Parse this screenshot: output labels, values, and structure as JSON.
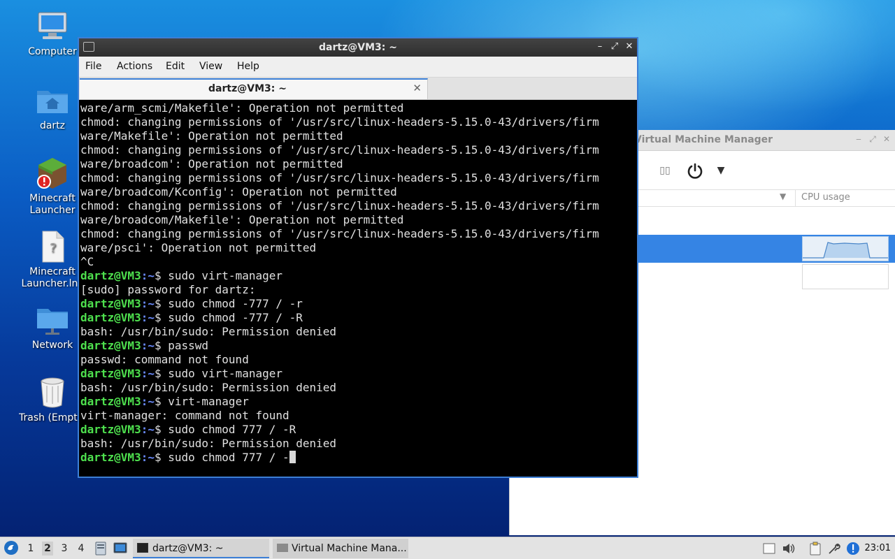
{
  "desktop": {
    "icons": [
      {
        "label": "Computer",
        "icon": "computer-icon"
      },
      {
        "label": "dartz",
        "icon": "home-folder-icon"
      },
      {
        "label": "Minecraft Launcher",
        "icon": "minecraft-icon"
      },
      {
        "label": "Minecraft Launcher.lnk",
        "icon": "file-icon"
      },
      {
        "label": "Network",
        "icon": "network-folder-icon"
      },
      {
        "label": "Trash (Empty)",
        "icon": "trash-icon"
      }
    ]
  },
  "terminal": {
    "title": "dartz@VM3: ~",
    "menu": [
      "File",
      "Actions",
      "Edit",
      "View",
      "Help"
    ],
    "tab_label": "dartz@VM3: ~",
    "tab_close": "✕",
    "prompt_user": "dartz@VM3",
    "prompt_path": ":~",
    "lines": [
      {
        "type": "out",
        "text": "ware/arm_scmi/Makefile': Operation not permitted"
      },
      {
        "type": "out",
        "text": "chmod: changing permissions of '/usr/src/linux-headers-5.15.0-43/drivers/firm"
      },
      {
        "type": "out",
        "text": "ware/Makefile': Operation not permitted"
      },
      {
        "type": "out",
        "text": "chmod: changing permissions of '/usr/src/linux-headers-5.15.0-43/drivers/firm"
      },
      {
        "type": "out",
        "text": "ware/broadcom': Operation not permitted"
      },
      {
        "type": "out",
        "text": "chmod: changing permissions of '/usr/src/linux-headers-5.15.0-43/drivers/firm"
      },
      {
        "type": "out",
        "text": "ware/broadcom/Kconfig': Operation not permitted"
      },
      {
        "type": "out",
        "text": "chmod: changing permissions of '/usr/src/linux-headers-5.15.0-43/drivers/firm"
      },
      {
        "type": "out",
        "text": "ware/broadcom/Makefile': Operation not permitted"
      },
      {
        "type": "out",
        "text": "chmod: changing permissions of '/usr/src/linux-headers-5.15.0-43/drivers/firm"
      },
      {
        "type": "out",
        "text": "ware/psci': Operation not permitted"
      },
      {
        "type": "out",
        "text": "^C"
      },
      {
        "type": "cmd",
        "text": "$ sudo virt-manager"
      },
      {
        "type": "out",
        "text": "[sudo] password for dartz:"
      },
      {
        "type": "cmd",
        "text": "$ sudo chmod -777 / -r"
      },
      {
        "type": "cmd",
        "text": "$ sudo chmod -777 / -R"
      },
      {
        "type": "out",
        "text": "bash: /usr/bin/sudo: Permission denied"
      },
      {
        "type": "cmd",
        "text": "$ passwd"
      },
      {
        "type": "out",
        "text": "passwd: command not found"
      },
      {
        "type": "cmd",
        "text": "$ sudo virt-manager"
      },
      {
        "type": "out",
        "text": "bash: /usr/bin/sudo: Permission denied"
      },
      {
        "type": "cmd",
        "text": "$ virt-manager"
      },
      {
        "type": "out",
        "text": "virt-manager: command not found"
      },
      {
        "type": "cmd",
        "text": "$ sudo chmod 777 / -R"
      },
      {
        "type": "out",
        "text": "bash: /usr/bin/sudo: Permission denied"
      },
      {
        "type": "cmd",
        "text": "$ sudo chmod 777 / -",
        "cursor": true
      }
    ]
  },
  "vmm": {
    "title": "Virtual Machine Manager",
    "column_cpu": "CPU usage"
  },
  "taskbar": {
    "workspaces": [
      "1",
      "2",
      "3",
      "4"
    ],
    "active_workspace": "2",
    "tasks": [
      {
        "label": "dartz@VM3: ~",
        "icon": "terminal-icon",
        "active": true
      },
      {
        "label": "Virtual Machine Mana...",
        "icon": "virt-manager-icon",
        "active": false
      }
    ],
    "clock": "23:01"
  }
}
